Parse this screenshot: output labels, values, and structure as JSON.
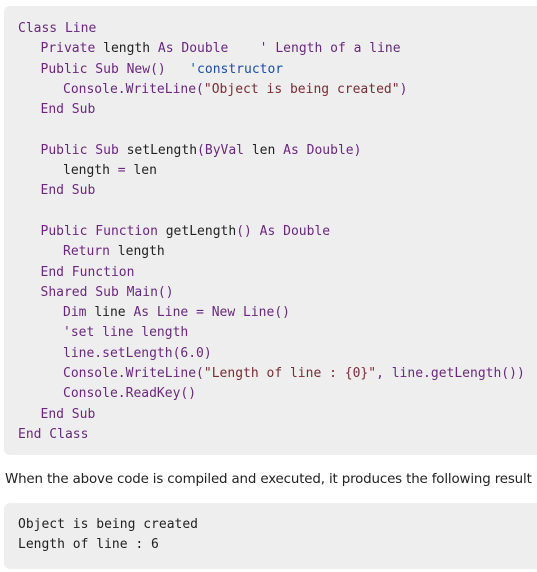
{
  "code_lines": [
    {
      "indent": 0,
      "tokens": [
        {
          "text": "Class ",
          "kind": "kw"
        },
        {
          "text": "Line",
          "kind": "kw"
        }
      ]
    },
    {
      "indent": 1,
      "tokens": [
        {
          "text": "Private ",
          "kind": "kw"
        },
        {
          "text": "length ",
          "kind": "tx"
        },
        {
          "text": "As Double",
          "kind": "kw"
        },
        {
          "text": "    ' Length of a line",
          "kind": "kw"
        }
      ]
    },
    {
      "indent": 1,
      "tokens": [
        {
          "text": "Public Sub New()",
          "kind": "kw"
        },
        {
          "text": "   'constructor",
          "kind": "cm"
        }
      ]
    },
    {
      "indent": 2,
      "tokens": [
        {
          "text": "Console.WriteLine(",
          "kind": "kw"
        },
        {
          "text": "\"Object is being created\"",
          "kind": "st"
        },
        {
          "text": ")",
          "kind": "kw"
        }
      ]
    },
    {
      "indent": 1,
      "tokens": [
        {
          "text": "End Sub",
          "kind": "kw"
        }
      ]
    },
    {
      "indent": 0,
      "tokens": []
    },
    {
      "indent": 1,
      "tokens": [
        {
          "text": "Public Sub ",
          "kind": "kw"
        },
        {
          "text": "setLength",
          "kind": "tx"
        },
        {
          "text": "(ByVal ",
          "kind": "kw"
        },
        {
          "text": "len ",
          "kind": "tx"
        },
        {
          "text": "As Double)",
          "kind": "kw"
        }
      ]
    },
    {
      "indent": 2,
      "tokens": [
        {
          "text": "length ",
          "kind": "tx"
        },
        {
          "text": "= ",
          "kind": "kw"
        },
        {
          "text": "len",
          "kind": "tx"
        }
      ]
    },
    {
      "indent": 1,
      "tokens": [
        {
          "text": "End Sub",
          "kind": "kw"
        }
      ]
    },
    {
      "indent": 0,
      "tokens": []
    },
    {
      "indent": 1,
      "tokens": [
        {
          "text": "Public Function ",
          "kind": "kw"
        },
        {
          "text": "getLength",
          "kind": "tx"
        },
        {
          "text": "() As Double",
          "kind": "kw"
        }
      ]
    },
    {
      "indent": 2,
      "tokens": [
        {
          "text": "Return ",
          "kind": "kw"
        },
        {
          "text": "length",
          "kind": "tx"
        }
      ]
    },
    {
      "indent": 1,
      "tokens": [
        {
          "text": "End Function",
          "kind": "kw"
        }
      ]
    },
    {
      "indent": 1,
      "tokens": [
        {
          "text": "Shared Sub ",
          "kind": "kw"
        },
        {
          "text": "Main()",
          "kind": "kw"
        }
      ]
    },
    {
      "indent": 2,
      "tokens": [
        {
          "text": "Dim ",
          "kind": "kw"
        },
        {
          "text": "line ",
          "kind": "tx"
        },
        {
          "text": "As Line = New Line()",
          "kind": "kw"
        }
      ]
    },
    {
      "indent": 2,
      "tokens": [
        {
          "text": "'set line length",
          "kind": "kw"
        }
      ]
    },
    {
      "indent": 2,
      "tokens": [
        {
          "text": "line.setLength(6.0)",
          "kind": "kw"
        }
      ]
    },
    {
      "indent": 2,
      "tokens": [
        {
          "text": "Console.WriteLine(",
          "kind": "kw"
        },
        {
          "text": "\"Length of line : {0}\"",
          "kind": "st"
        },
        {
          "text": ", line.getLength())",
          "kind": "kw"
        }
      ]
    },
    {
      "indent": 2,
      "tokens": [
        {
          "text": "Console.ReadKey()",
          "kind": "kw"
        }
      ]
    },
    {
      "indent": 1,
      "tokens": [
        {
          "text": "End Sub",
          "kind": "kw"
        }
      ]
    },
    {
      "indent": 0,
      "tokens": [
        {
          "text": "End Class",
          "kind": "kw"
        }
      ]
    }
  ],
  "description": "When the above code is compiled and executed, it produces the following result −",
  "output_lines": [
    "Object is being created",
    "Length of line : 6"
  ],
  "colors": {
    "keyword": "#6b2780",
    "plain": "#222222",
    "string": "#7a2c33",
    "comment": "#1a4fa8",
    "code_background": "#eeeeee"
  }
}
